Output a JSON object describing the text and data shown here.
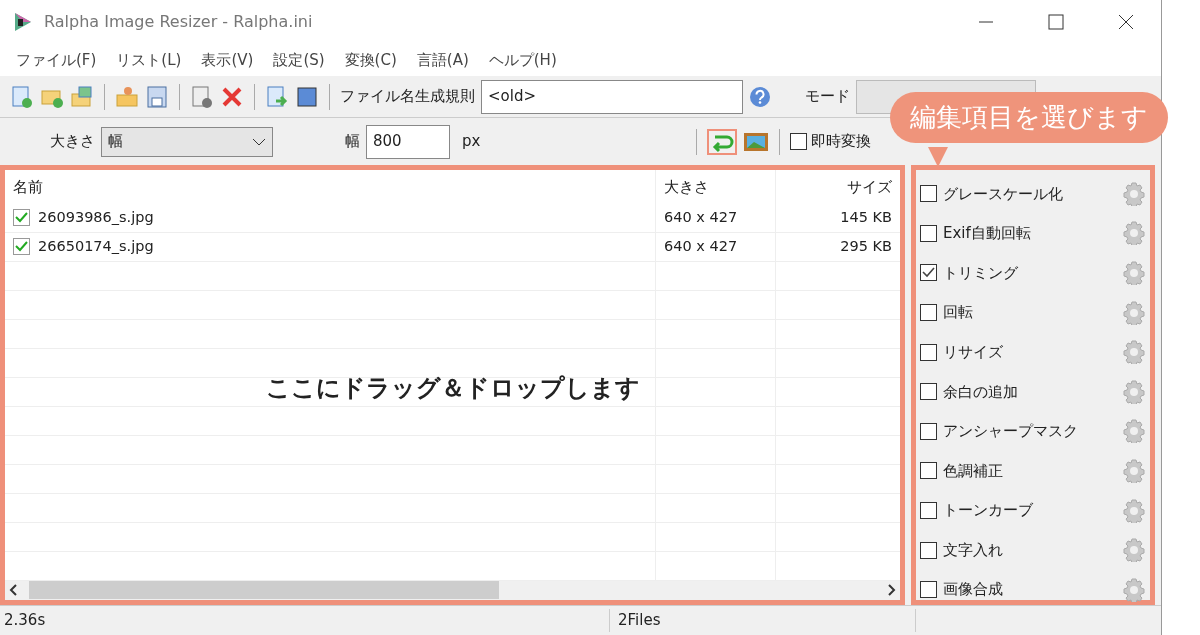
{
  "window": {
    "title": "Ralpha Image Resizer - Ralpha.ini"
  },
  "menu": [
    "ファイル(F)",
    "リスト(L)",
    "表示(V)",
    "設定(S)",
    "変換(C)",
    "言語(A)",
    "ヘルプ(H)"
  ],
  "toolbar": {
    "rule_label": "ファイル名生成規則",
    "rule_value": "<old>",
    "mode_label": "モード"
  },
  "size_bar": {
    "size_label": "大きさ",
    "size_value": "幅",
    "width_label": "幅",
    "width_value": "800",
    "unit": "px",
    "instant": {
      "label": "即時変換",
      "checked": false
    }
  },
  "file_list": {
    "columns": [
      "名前",
      "大きさ",
      "サイズ"
    ],
    "rows": [
      {
        "name": "26093986_s.jpg",
        "dims": "640 x 427",
        "size": "145 KB",
        "checked": true
      },
      {
        "name": "26650174_s.jpg",
        "dims": "640 x 427",
        "size": "295 KB",
        "checked": true
      }
    ],
    "drop_hint": "ここにドラッグ＆ドロップします"
  },
  "edit_items": [
    {
      "label": "グレースケール化",
      "checked": false
    },
    {
      "label": "Exif自動回転",
      "checked": false
    },
    {
      "label": "トリミング",
      "checked": true
    },
    {
      "label": "回転",
      "checked": false
    },
    {
      "label": "リサイズ",
      "checked": false
    },
    {
      "label": "余白の追加",
      "checked": false
    },
    {
      "label": "アンシャープマスク",
      "checked": false
    },
    {
      "label": "色調補正",
      "checked": false
    },
    {
      "label": "トーンカーブ",
      "checked": false
    },
    {
      "label": "文字入れ",
      "checked": false
    },
    {
      "label": "画像合成",
      "checked": false
    }
  ],
  "callout": "編集項目を選びます",
  "status_bar": [
    "2.36s",
    "2Files"
  ]
}
